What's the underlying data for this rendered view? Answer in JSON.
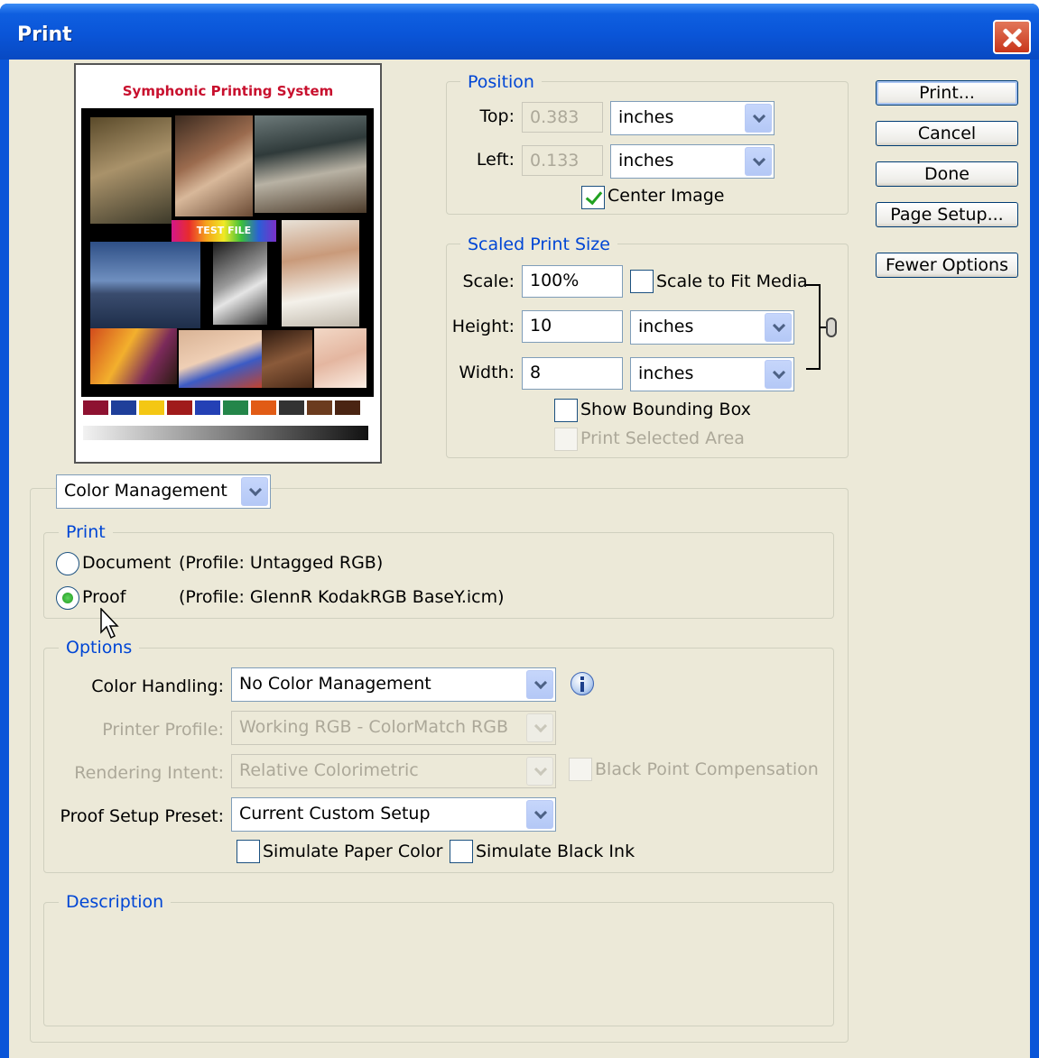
{
  "window": {
    "title": "Print"
  },
  "preview": {
    "doc_title": "Symphonic Printing System",
    "test_label": "TEST FILE",
    "swatch_colors": [
      "#8e1231",
      "#1f3f9a",
      "#f4c714",
      "#a01b1b",
      "#2441b5",
      "#24864a",
      "#e15b15",
      "#333333",
      "#6b3b1e",
      "#4a2412"
    ]
  },
  "position": {
    "legend": "Position",
    "top_label": "Top:",
    "top_value": "0.383",
    "top_units": "inches",
    "left_label": "Left:",
    "left_value": "0.133",
    "left_units": "inches",
    "center_image_label": "Center Image",
    "center_image_checked": true
  },
  "scaled": {
    "legend": "Scaled Print Size",
    "scale_label": "Scale:",
    "scale_value": "100%",
    "scale_to_fit_label": "Scale to Fit Media",
    "height_label": "Height:",
    "height_value": "10",
    "height_units": "inches",
    "width_label": "Width:",
    "width_value": "8",
    "width_units": "inches",
    "show_bounding_box_label": "Show Bounding Box",
    "print_selected_area_label": "Print Selected Area"
  },
  "buttons": {
    "print": "Print...",
    "cancel": "Cancel",
    "done": "Done",
    "page_setup": "Page Setup...",
    "fewer_options": "Fewer Options"
  },
  "section_select": "Color Management",
  "print_group": {
    "legend": "Print",
    "document_label": "Document",
    "document_profile": "(Profile: Untagged RGB)",
    "proof_label": "Proof",
    "proof_profile": "(Profile: GlennR KodakRGB BaseY.icm)",
    "selected": "proof"
  },
  "options": {
    "legend": "Options",
    "color_handling_label": "Color Handling:",
    "color_handling_value": "No Color Management",
    "printer_profile_label": "Printer Profile:",
    "printer_profile_value": "Working RGB - ColorMatch RGB",
    "rendering_intent_label": "Rendering Intent:",
    "rendering_intent_value": "Relative Colorimetric",
    "black_point_label": "Black Point Compensation",
    "proof_preset_label": "Proof Setup Preset:",
    "proof_preset_value": "Current Custom Setup",
    "simulate_paper_label": "Simulate Paper Color",
    "simulate_black_label": "Simulate Black Ink"
  },
  "description": {
    "legend": "Description"
  }
}
